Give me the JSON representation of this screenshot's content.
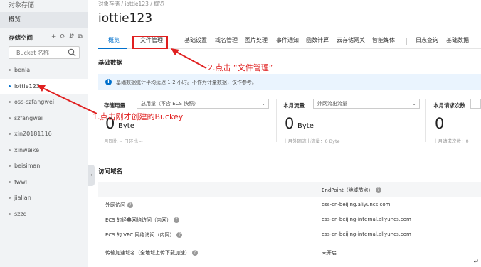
{
  "sidebar": {
    "title": "对象存储",
    "overview": "概览",
    "buckets_label": "存储空间",
    "tools": [
      "+",
      "⟳",
      "⇵",
      "⧉"
    ],
    "search_placeholder": "Bucket 名称",
    "items": [
      {
        "label": "benlai",
        "active": false
      },
      {
        "label": "iottie123",
        "active": true
      },
      {
        "label": "oss-szfangwei",
        "active": false
      },
      {
        "label": "szfangwei",
        "active": false
      },
      {
        "label": "xin20181116",
        "active": false
      },
      {
        "label": "xinweike",
        "active": false
      },
      {
        "label": "beisiman",
        "active": false
      },
      {
        "label": "fwwl",
        "active": false
      },
      {
        "label": "jialian",
        "active": false
      },
      {
        "label": "szzq",
        "active": false
      }
    ]
  },
  "main": {
    "breadcrumb": "对象存储 / iottie123 / 概览",
    "title": "iottie123",
    "tabs": [
      "概览",
      "文件管理",
      "基础设置",
      "域名管理",
      "图片处理",
      "事件通知",
      "函数计算",
      "云存储网关",
      "智能媒体",
      "日志查询",
      "基础数据"
    ],
    "basic_data_title": "基础数据",
    "info_text": "基础数据统计平均延迟 1-2 小时。不作为计量数据，仅作参考。",
    "cards": [
      {
        "label": "存储用量",
        "select": "总用量（不含 ECS 快照）",
        "value": "0",
        "unit": "Byte",
        "sub": "月同比 -- 日环比 --"
      },
      {
        "label": "本月流量",
        "select": "外网流出流量",
        "value": "0",
        "unit": "Byte",
        "sub": "上月外网流出流量：0 Byte"
      },
      {
        "label": "本月请求次数",
        "select": "",
        "value": "0",
        "unit": "",
        "sub": "上月请求次数：0"
      }
    ],
    "domain_title": "访问域名",
    "table": {
      "header_right": "EndPoint（地域节点）",
      "rows": [
        {
          "left": "外网访问",
          "right": "oss-cn-beijing.aliyuncs.com"
        },
        {
          "left": "ECS 的经典网络访问（内网）",
          "right": "oss-cn-beijing-internal.aliyuncs.com"
        },
        {
          "left": "ECS 的 VPC 网络访问（内网）",
          "right": "oss-cn-beijing-internal.aliyuncs.com"
        },
        {
          "left": "传输加速域名（全地域上传下载加速）",
          "right": "未开启"
        }
      ]
    }
  },
  "annotations": {
    "step1": "1.点击刚才创建的Buckey",
    "step2": "2.点击 “文件管理”",
    "color": "#e02020"
  },
  "colors": {
    "accent": "#0070cc",
    "sidebar_bg": "#f1f3f5",
    "info_bg": "#eaf4fe"
  },
  "icons": {
    "search": "search-icon",
    "info": "info-icon",
    "help": "question-icon",
    "collapse": "chevron-left-icon"
  }
}
